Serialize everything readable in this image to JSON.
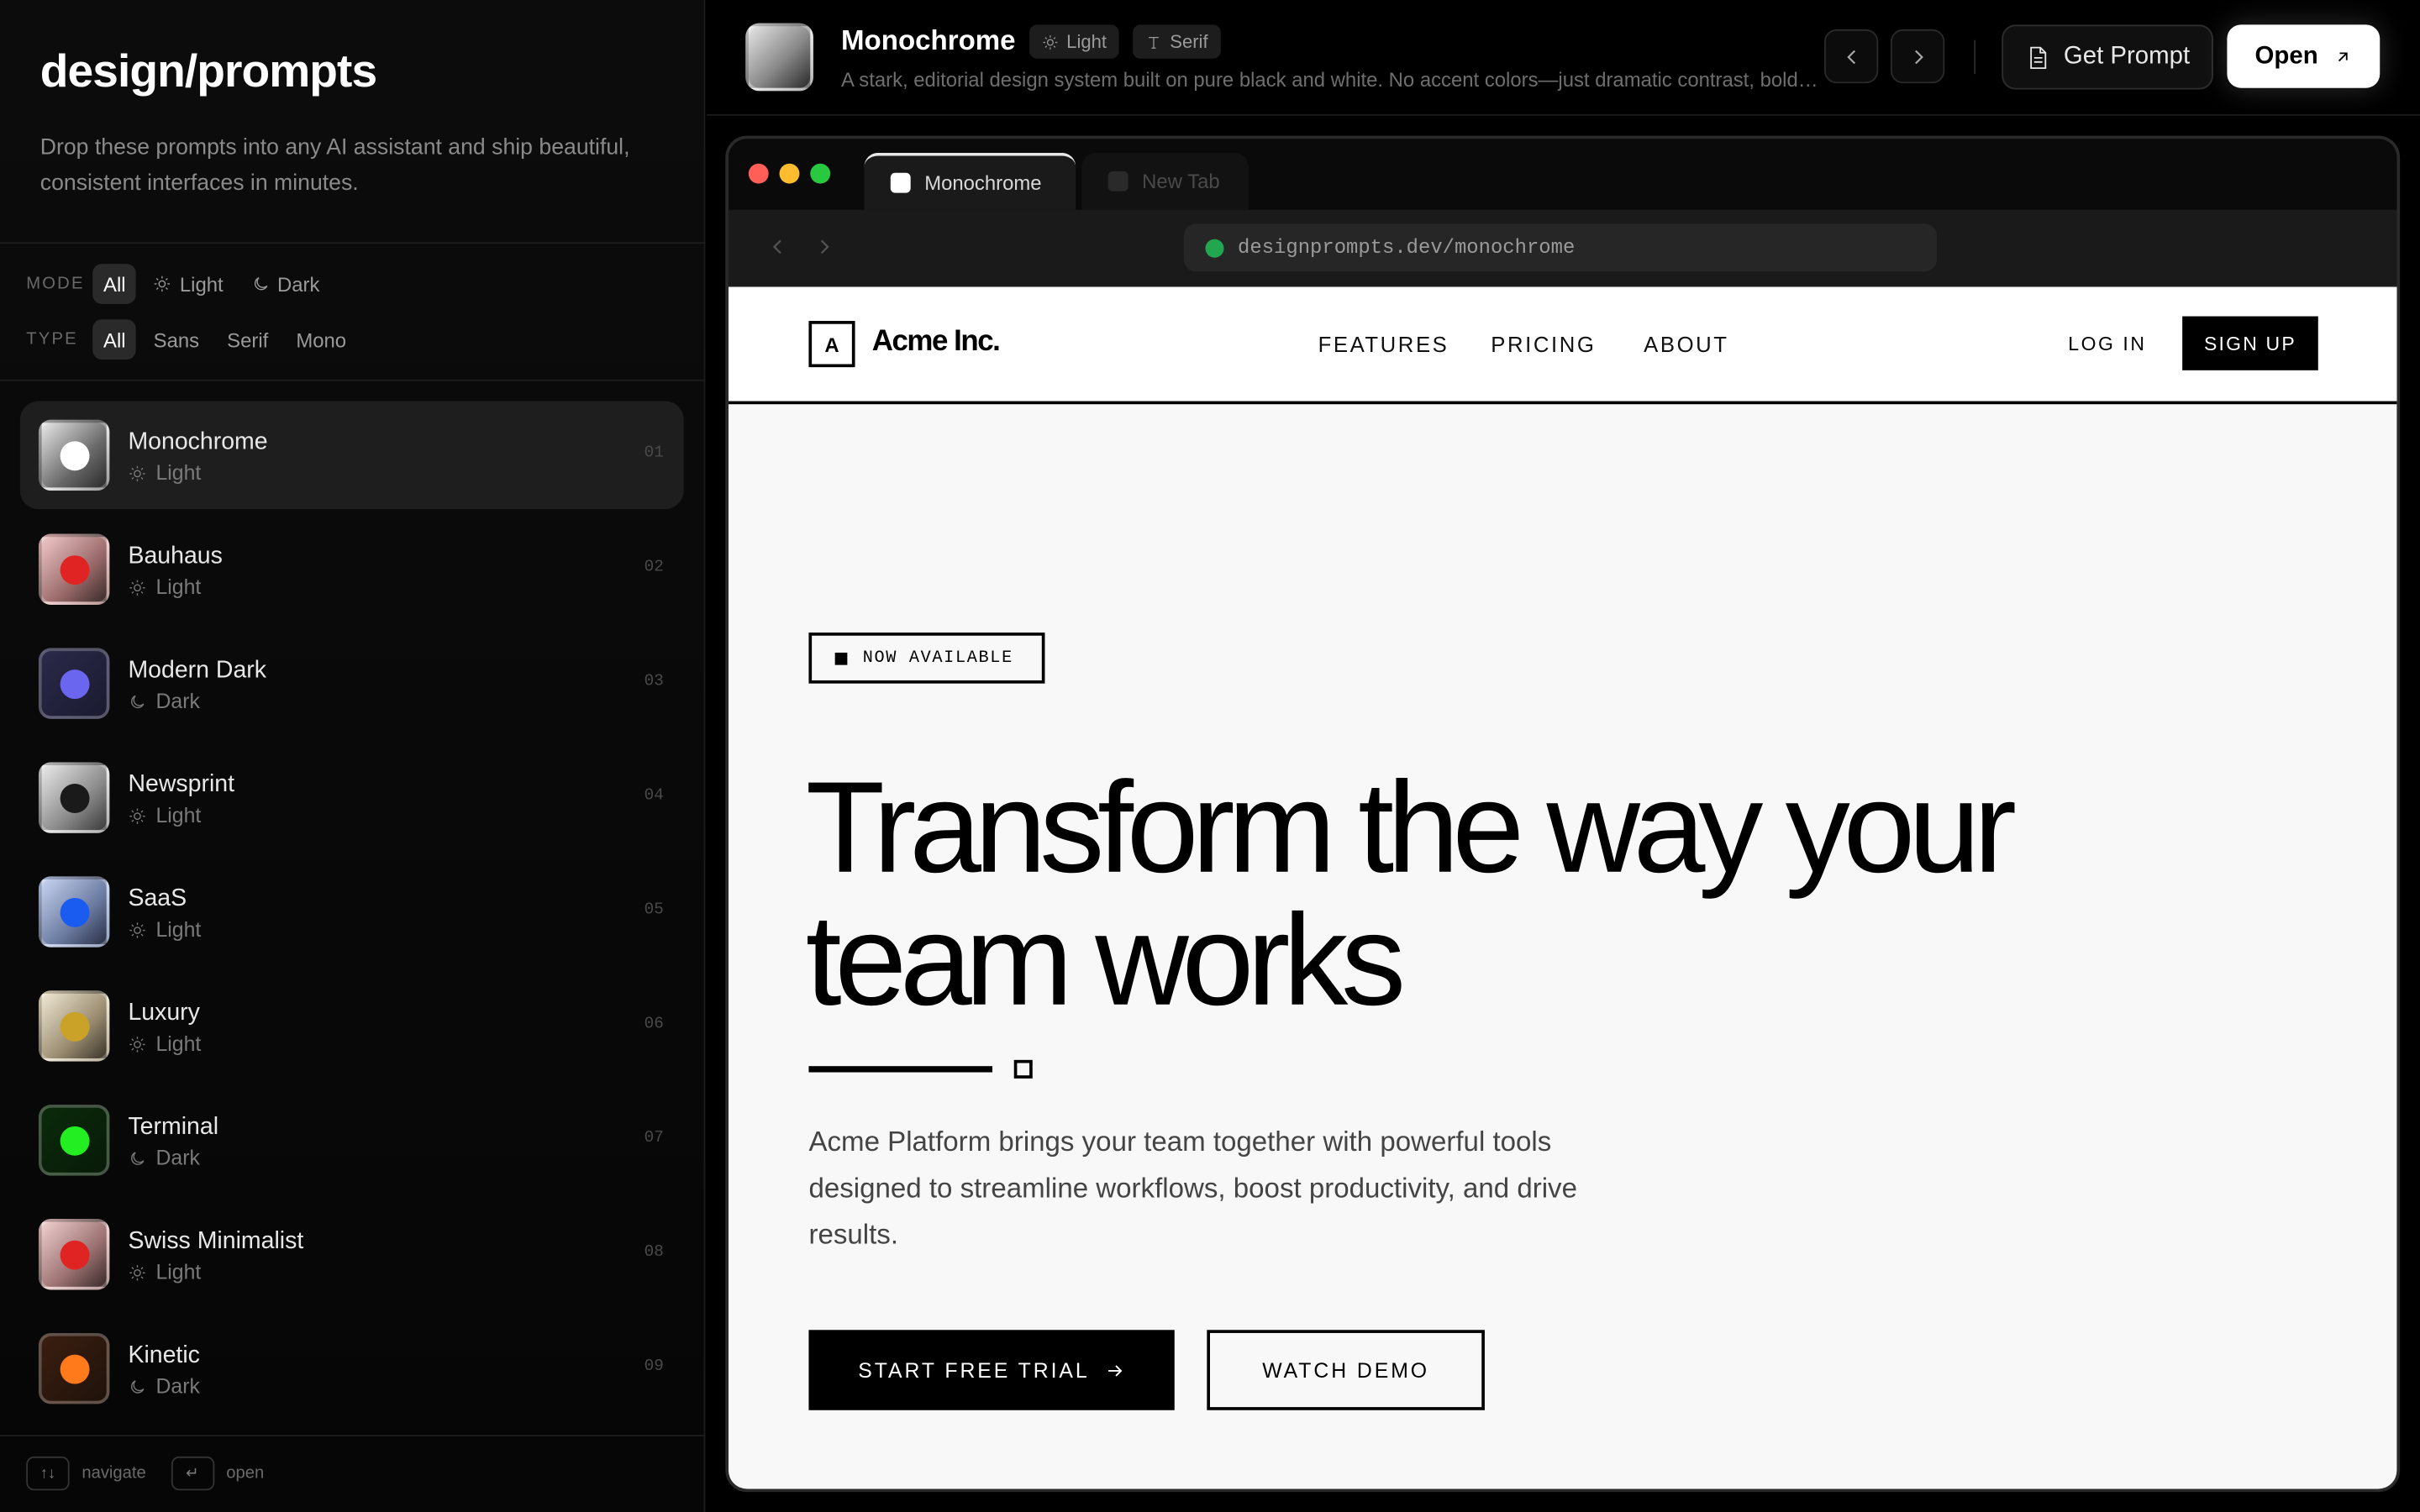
{
  "sidebar": {
    "brand": "design/prompts",
    "tagline": "Drop these prompts into any AI assistant and ship beautiful, consistent interfaces in minutes.",
    "mode_filter": {
      "label": "MODE",
      "options": [
        {
          "label": "All",
          "active": true,
          "icon": ""
        },
        {
          "label": "Light",
          "active": false,
          "icon": "sun-icon"
        },
        {
          "label": "Dark",
          "active": false,
          "icon": "moon-icon"
        }
      ]
    },
    "type_filter": {
      "label": "TYPE",
      "options": [
        {
          "label": "All",
          "active": true
        },
        {
          "label": "Sans",
          "active": false
        },
        {
          "label": "Serif",
          "active": false
        },
        {
          "label": "Mono",
          "active": false
        }
      ]
    },
    "themes": [
      {
        "name": "Monochrome",
        "mode": "Light",
        "mode_icon": "sun-icon",
        "num": "01",
        "color": "#ffffff",
        "bg": "linear-gradient(135deg,#e8e8e8,#6a6a6a 60%,#2a2a2a)",
        "selected": true
      },
      {
        "name": "Bauhaus",
        "mode": "Light",
        "mode_icon": "sun-icon",
        "num": "02",
        "color": "#e02424",
        "bg": "linear-gradient(135deg,#f0c8c8,#9a6a6a 60%,#3a2a2a)",
        "selected": false
      },
      {
        "name": "Modern Dark",
        "mode": "Dark",
        "mode_icon": "moon-icon",
        "num": "03",
        "color": "#6a66f0",
        "bg": "linear-gradient(135deg,#2a2a4a,#1a1a30)",
        "selected": false
      },
      {
        "name": "Newsprint",
        "mode": "Light",
        "mode_icon": "sun-icon",
        "num": "04",
        "color": "#1a1a1a",
        "bg": "linear-gradient(135deg,#eaeaea,#8a8a8a 60%,#3a3a3a)",
        "selected": false
      },
      {
        "name": "SaaS",
        "mode": "Light",
        "mode_icon": "sun-icon",
        "num": "05",
        "color": "#1a5cf0",
        "bg": "linear-gradient(135deg,#c8d4f0,#6a7aa0 60%,#2a2f45)",
        "selected": false
      },
      {
        "name": "Luxury",
        "mode": "Light",
        "mode_icon": "sun-icon",
        "num": "06",
        "color": "#c9a227",
        "bg": "linear-gradient(135deg,#f0e8d4,#9a8c70 60%,#3a352a)",
        "selected": false
      },
      {
        "name": "Terminal",
        "mode": "Dark",
        "mode_icon": "moon-icon",
        "num": "07",
        "color": "#22ee22",
        "bg": "linear-gradient(135deg,#0a2a0a,#081a08)",
        "selected": false
      },
      {
        "name": "Swiss Minimalist",
        "mode": "Light",
        "mode_icon": "sun-icon",
        "num": "08",
        "color": "#e02424",
        "bg": "linear-gradient(135deg,#f0d0d0,#9a7070 60%,#3a2a2a)",
        "selected": false
      },
      {
        "name": "Kinetic",
        "mode": "Dark",
        "mode_icon": "moon-icon",
        "num": "09",
        "color": "#ff7a1a",
        "bg": "linear-gradient(135deg,#3a1e10,#20120a)",
        "selected": false
      }
    ],
    "footer": {
      "nav_key": "↑↓",
      "nav_label": "navigate",
      "open_key": "↵",
      "open_label": "open"
    }
  },
  "topbar": {
    "title": "Monochrome",
    "mode_tag": "Light",
    "type_tag": "Serif",
    "description": "A stark, editorial design system built on pure black and white. No accent colors—just dramatic contrast, bold typography, and uncompromising restraint.",
    "get_prompt_label": "Get Prompt",
    "open_label": "Open"
  },
  "browser": {
    "active_tab": "Monochrome",
    "inactive_tab": "New Tab",
    "url": "designprompts.dev/monochrome"
  },
  "site": {
    "logo_mark": "A",
    "logo_text": "Acme Inc.",
    "nav": [
      "FEATURES",
      "PRICING",
      "ABOUT"
    ],
    "login": "LOG IN",
    "signup": "SIGN UP",
    "badge": "NOW AVAILABLE",
    "headline_line1": "Transform the way your",
    "headline_line2": "team works",
    "subtext": "Acme Platform brings your team together with powerful tools designed to streamline workflows, boost productivity, and drive results.",
    "cta_primary": "START FREE TRIAL",
    "cta_secondary": "WATCH DEMO"
  }
}
